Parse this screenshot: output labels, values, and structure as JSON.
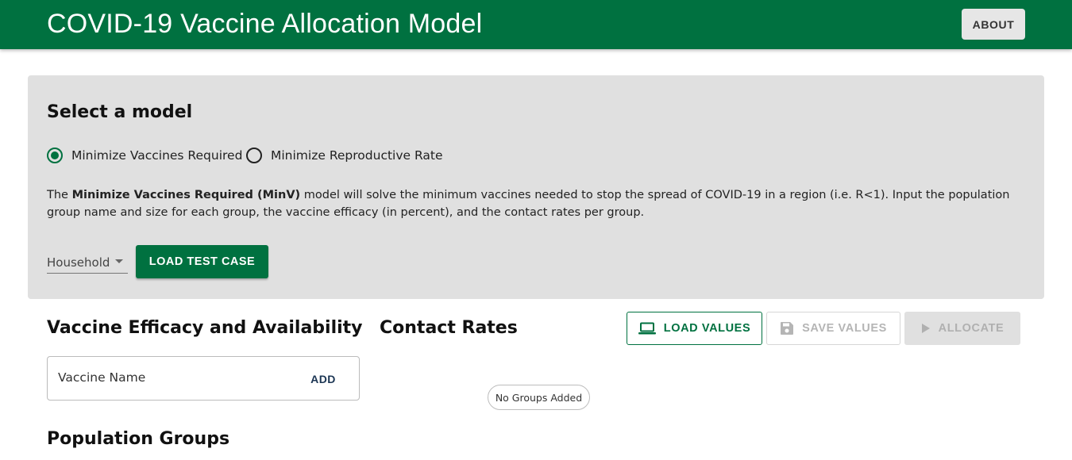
{
  "header": {
    "title": "COVID-19 Vaccine Allocation Model",
    "about_label": "ABOUT"
  },
  "model_card": {
    "title": "Select a model",
    "options": [
      {
        "label": "Minimize Vaccines Required",
        "selected": true
      },
      {
        "label": "Minimize Reproductive Rate",
        "selected": false
      }
    ],
    "description_intro": "The ",
    "description_bold": "Minimize Vaccines Required (MinV)",
    "description_rest": " model will solve the minimum vaccines needed to stop the spread of COVID-19 in a region (i.e. R<1). Input the population group name and size for each group, the vaccine efficacy (in percent), and the contact rates per group.",
    "test_case_select": "Household",
    "load_test_case_label": "LOAD TEST CASE"
  },
  "vaccine_section": {
    "title": "Vaccine Efficacy and Availability",
    "input_label": "Vaccine Name",
    "add_label": "ADD"
  },
  "contact_section": {
    "title": "Contact Rates",
    "empty_chip": "No Groups Added"
  },
  "actions": {
    "load_values": "LOAD VALUES",
    "save_values": "SAVE VALUES",
    "allocate": "ALLOCATE"
  },
  "population_section": {
    "title": "Population Groups"
  },
  "colors": {
    "primary": "#007140",
    "card_bg": "#e0e0e0",
    "disabled_text": "#b5b5b5"
  }
}
